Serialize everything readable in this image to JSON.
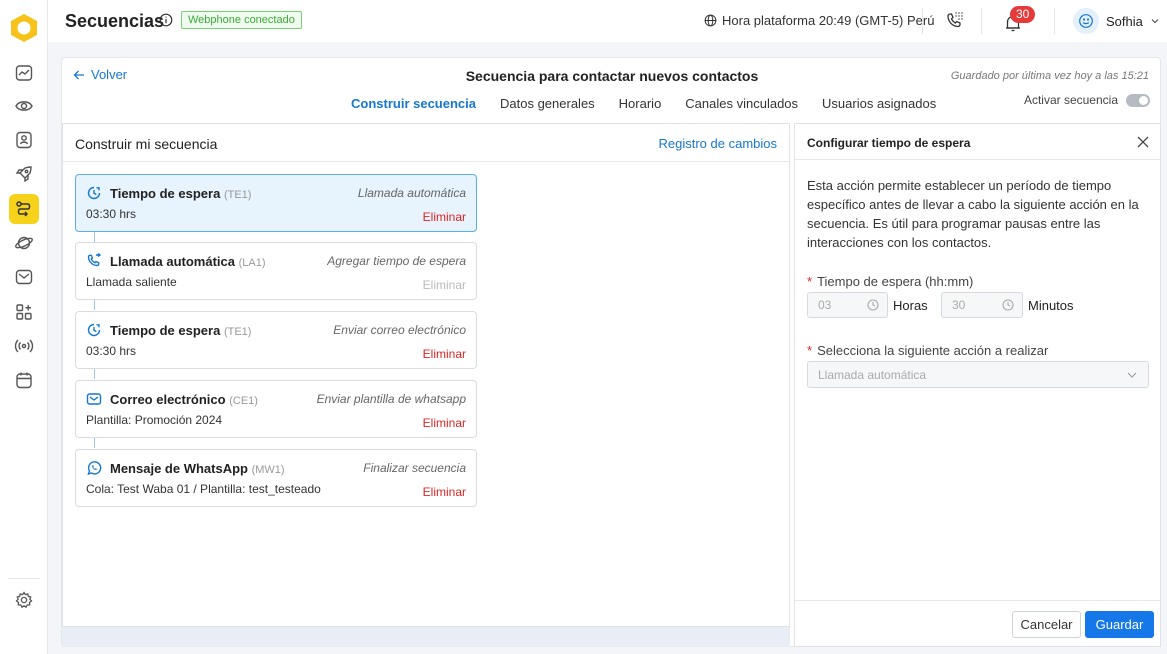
{
  "header": {
    "title": "Secuencias",
    "webphone_badge": "Webphone conectado",
    "platform_time": "Hora plataforma 20:49 (GMT-5) Perú",
    "notifications_count": "30",
    "user_name": "Sofhia"
  },
  "sidebar": {
    "items": [
      {
        "icon": "activity-icon"
      },
      {
        "icon": "eye-icon"
      },
      {
        "icon": "contact-card-icon"
      },
      {
        "icon": "rocket-icon"
      },
      {
        "icon": "sequences-icon",
        "active": true
      },
      {
        "icon": "planet-icon"
      },
      {
        "icon": "mail-icon"
      },
      {
        "icon": "apps-add-icon"
      },
      {
        "icon": "broadcast-icon"
      },
      {
        "icon": "calendar-icon"
      },
      {
        "icon": "settings-icon"
      }
    ]
  },
  "page": {
    "back_label": "Volver",
    "sequence_title": "Secuencia para contactar nuevos contactos",
    "saved_text": "Guardado por última vez hoy a las 15:21",
    "tabs": [
      "Construir secuencia",
      "Datos generales",
      "Horario",
      "Canales vinculados",
      "Usuarios asignados"
    ],
    "active_tab": "Construir secuencia",
    "activate_label": "Activar secuencia",
    "activate_on": false
  },
  "builder": {
    "title": "Construir mi secuencia",
    "changes_link": "Registro de cambios",
    "steps": [
      {
        "icon": "clock-icon",
        "name": "Tiempo de espera",
        "code": "(TE1)",
        "next": "Llamada automática",
        "detail": "03:30 hrs",
        "delete": "Eliminar",
        "selected": true,
        "delete_enabled": true
      },
      {
        "icon": "phone-call-icon",
        "name": "Llamada automática",
        "code": "(LA1)",
        "next": "Agregar tiempo de espera",
        "detail": "Llamada saliente",
        "delete": "Eliminar",
        "selected": false,
        "delete_enabled": false
      },
      {
        "icon": "clock-icon",
        "name": "Tiempo de espera",
        "code": "(TE1)",
        "next": "Enviar correo electrónico",
        "detail": "03:30 hrs",
        "delete": "Eliminar",
        "selected": false,
        "delete_enabled": true
      },
      {
        "icon": "mail-icon",
        "name": "Correo electrónico",
        "code": "(CE1)",
        "next": "Enviar plantilla de whatsapp",
        "detail": "Plantilla: Promoción 2024",
        "delete": "Eliminar",
        "selected": false,
        "delete_enabled": true
      },
      {
        "icon": "whatsapp-icon",
        "name": "Mensaje de WhatsApp",
        "code": "(MW1)",
        "next": "Finalizar secuencia",
        "detail": "Cola: Test Waba 01 / Plantilla: test_testeado",
        "delete": "Eliminar",
        "selected": false,
        "delete_enabled": true
      }
    ]
  },
  "config": {
    "title": "Configurar tiempo de espera",
    "description": "Esta acción permite establecer un período de tiempo específico antes de llevar a cabo la siguiente acción en la secuencia. Es útil para programar pausas entre las interacciones con los contactos.",
    "wait_label": "Tiempo de espera (hh:mm)",
    "hours_value": "03",
    "hours_unit": "Horas",
    "minutes_value": "30",
    "minutes_unit": "Minutos",
    "next_action_label": "Selecciona la siguiente acción a realizar",
    "next_action_value": "Llamada automática",
    "cancel_label": "Cancelar",
    "save_label": "Guardar"
  },
  "colors": {
    "accent": "#1677d2",
    "active_nav": "#f7d21a",
    "danger": "#e02424",
    "badge_green": "#3bab37"
  }
}
